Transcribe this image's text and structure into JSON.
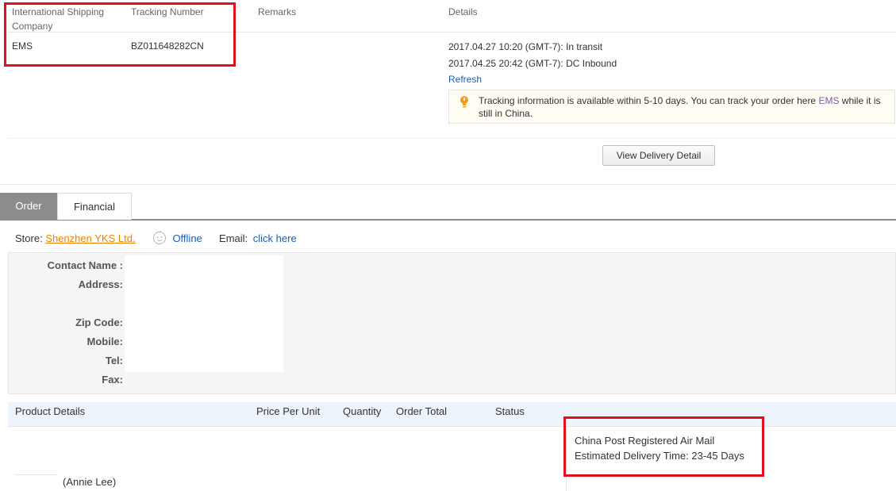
{
  "tracking": {
    "headers": {
      "company": "International Shipping Company",
      "tracking_number": "Tracking Number",
      "remarks": "Remarks",
      "details": "Details"
    },
    "row": {
      "company": "EMS",
      "tracking_number": "BZ011648282CN",
      "events": [
        "2017.04.27 10:20 (GMT-7): In transit",
        "2017.04.25 20:42 (GMT-7): DC Inbound"
      ],
      "refresh_label": "Refresh",
      "notice_prefix": "Tracking information is available within 5-10 days. You can track your order here ",
      "notice_link": "EMS",
      "notice_suffix": " while it is still in China."
    },
    "view_delivery_label": "View Delivery Detail"
  },
  "tabs": [
    {
      "label": "Order",
      "active": true
    },
    {
      "label": "Financial",
      "active": false
    }
  ],
  "store": {
    "label": "Store:",
    "name": "Shenzhen YKS Ltd.",
    "status": "Offline",
    "email_label": "Email:",
    "email_link": "click here"
  },
  "contact": {
    "contact_name_label": "Contact Name :",
    "address_label": "Address:",
    "zip_label": "Zip Code:",
    "mobile_label": "Mobile:",
    "tel_label": "Tel:",
    "fax_label": "Fax:"
  },
  "products": {
    "headers": {
      "details": "Product Details",
      "price": "Price Per Unit",
      "quantity": "Quantity",
      "total": "Order Total",
      "status": "Status"
    },
    "buyer_name": "(Annie Lee)",
    "shipping_method": "China Post Registered Air Mail",
    "delivery_label": "Estimated Delivery Time:",
    "delivery_value": "23-45 Days"
  },
  "colors": {
    "highlight_box": "#e0101f",
    "link_blue": "#1a5db4",
    "store_orange": "#f08200",
    "tab_active": "#8c8c8c",
    "notice_icon": "#f0a020"
  }
}
